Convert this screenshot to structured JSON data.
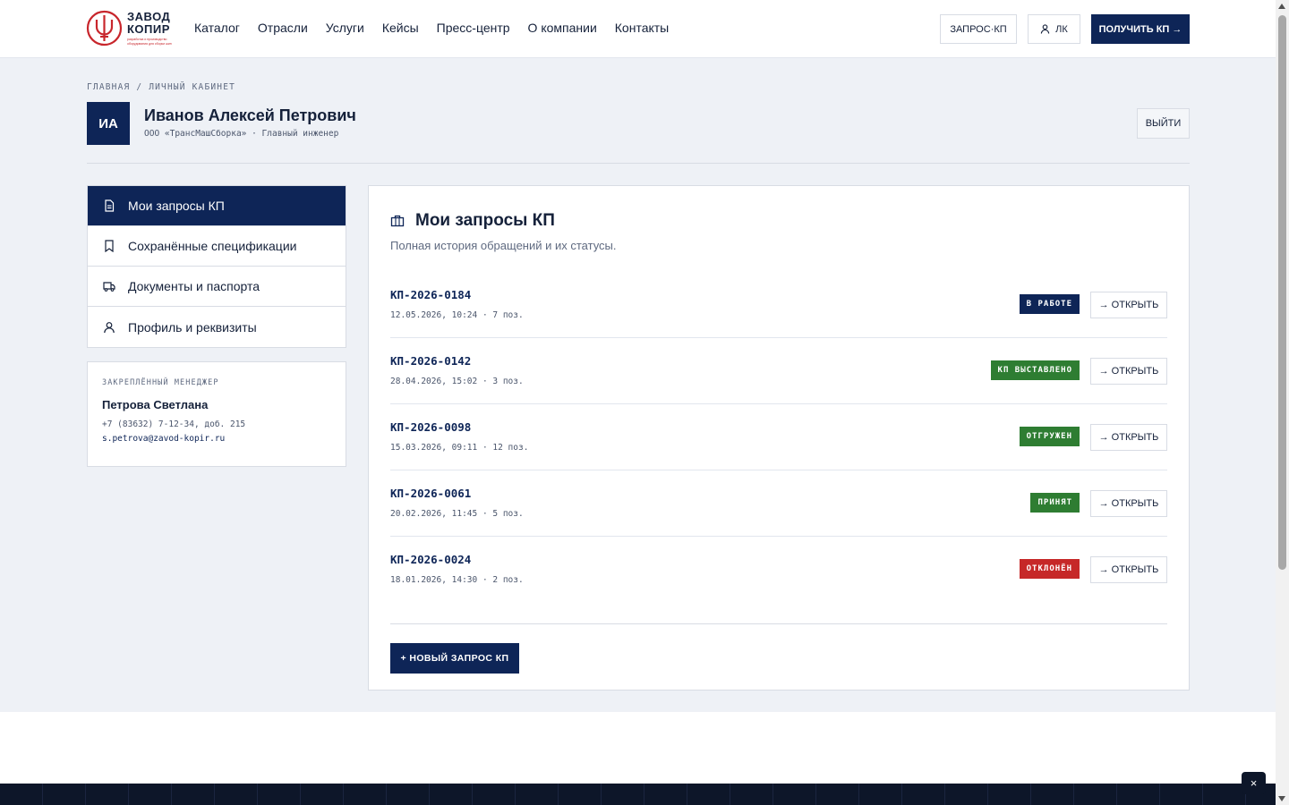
{
  "header": {
    "logo": {
      "line1": "ЗАВОД",
      "line2": "КОПИР",
      "tagline": "разработка и производство оборудования для сборки шин"
    },
    "nav": [
      "Каталог",
      "Отрасли",
      "Услуги",
      "Кейсы",
      "Пресс-центр",
      "О компании",
      "Контакты"
    ],
    "request_kp_label": "ЗАПРОС·КП",
    "lk_label": "ЛК",
    "get_kp_label": "ПОЛУЧИТЬ КП →"
  },
  "breadcrumb": "ГЛАВНАЯ / ЛИЧНЫЙ КАБИНЕТ",
  "user": {
    "initials": "ИА",
    "name": "Иванов Алексей Петрович",
    "subtitle": "ООО «ТрансМашСборка» · Главный инженер",
    "logout_label": "ВЫЙТИ"
  },
  "sidebar": {
    "items": [
      {
        "label": "Мои запросы КП",
        "icon": "document-icon",
        "active": true
      },
      {
        "label": "Сохранённые спецификации",
        "icon": "bookmark-icon",
        "active": false
      },
      {
        "label": "Документы и паспорта",
        "icon": "truck-icon",
        "active": false
      },
      {
        "label": "Профиль и реквизиты",
        "icon": "user-icon",
        "active": false
      }
    ]
  },
  "manager": {
    "label": "ЗАКРЕПЛЁННЫЙ МЕНЕДЖЕР",
    "name": "Петрова Светлана",
    "phone": "+7 (83632) 7-12-34, доб. 215",
    "email": "s.petrova@zavod-kopir.ru"
  },
  "content": {
    "title": "Мои запросы КП",
    "title_icon": "briefcase-icon",
    "subtitle": "Полная история обращений и их статусы.",
    "open_label": "→ ОТКРЫТЬ",
    "new_request_label": "+ НОВЫЙ ЗАПРОС КП",
    "requests": [
      {
        "id": "КП-2026-0184",
        "meta": "12.05.2026, 10:24 · 7 поз.",
        "status": "В РАБОТЕ",
        "status_color": "#0e2557"
      },
      {
        "id": "КП-2026-0142",
        "meta": "28.04.2026, 15:02 · 3 поз.",
        "status": "КП ВЫСТАВЛЕНО",
        "status_color": "#2e7d32"
      },
      {
        "id": "КП-2026-0098",
        "meta": "15.03.2026, 09:11 · 12 поз.",
        "status": "ОТГРУЖЕН",
        "status_color": "#2e7d32"
      },
      {
        "id": "КП-2026-0061",
        "meta": "20.02.2026, 11:45 · 5 поз.",
        "status": "ПРИНЯТ",
        "status_color": "#2e7d32"
      },
      {
        "id": "КП-2026-0024",
        "meta": "18.01.2026, 14:30 · 2 поз.",
        "status": "ОТКЛОНЁН",
        "status_color": "#c62828"
      }
    ]
  },
  "close_label": "×",
  "colors": {
    "primary": "#0e2557",
    "success": "#2e7d32",
    "danger": "#c62828",
    "brand_red": "#c8262c",
    "page_bg": "#eef1f6"
  }
}
